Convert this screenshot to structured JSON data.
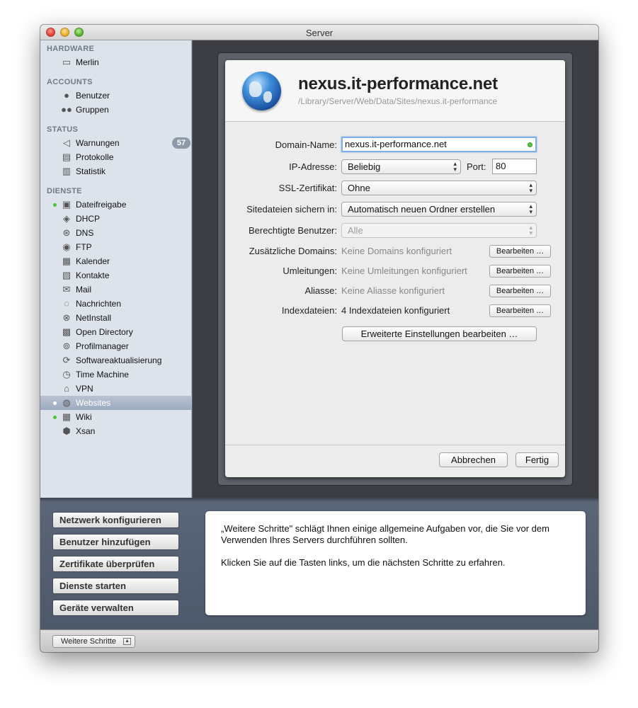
{
  "window": {
    "title": "Server"
  },
  "sidebar": {
    "sections": [
      {
        "title": "HARDWARE",
        "items": [
          {
            "label": "Merlin",
            "icon": "server-icon",
            "glyph": "▭"
          }
        ]
      },
      {
        "title": "ACCOUNTS",
        "items": [
          {
            "label": "Benutzer",
            "icon": "user-icon",
            "glyph": "●"
          },
          {
            "label": "Gruppen",
            "icon": "group-icon",
            "glyph": "●●"
          }
        ]
      },
      {
        "title": "STATUS",
        "items": [
          {
            "label": "Warnungen",
            "icon": "alert-megaphone-icon",
            "glyph": "◁",
            "badge": "57"
          },
          {
            "label": "Protokolle",
            "icon": "log-document-icon",
            "glyph": "▤"
          },
          {
            "label": "Statistik",
            "icon": "stats-bars-icon",
            "glyph": "▥"
          }
        ]
      },
      {
        "title": "DIENSTE",
        "items": [
          {
            "label": "Dateifreigabe",
            "icon": "file-sharing-icon",
            "glyph": "▣",
            "active": true
          },
          {
            "label": "DHCP",
            "icon": "dhcp-icon",
            "glyph": "◈"
          },
          {
            "label": "DNS",
            "icon": "dns-icon",
            "glyph": "⊛"
          },
          {
            "label": "FTP",
            "icon": "ftp-icon",
            "glyph": "◉"
          },
          {
            "label": "Kalender",
            "icon": "calendar-icon",
            "glyph": "▦"
          },
          {
            "label": "Kontakte",
            "icon": "contacts-icon",
            "glyph": "▧"
          },
          {
            "label": "Mail",
            "icon": "mail-icon",
            "glyph": "✉"
          },
          {
            "label": "Nachrichten",
            "icon": "messages-icon",
            "glyph": "◌"
          },
          {
            "label": "NetInstall",
            "icon": "netinstall-icon",
            "glyph": "⊗"
          },
          {
            "label": "Open Directory",
            "icon": "open-directory-icon",
            "glyph": "▩"
          },
          {
            "label": "Profilmanager",
            "icon": "profile-manager-icon",
            "glyph": "⊚"
          },
          {
            "label": "Softwareaktualisierung",
            "icon": "software-update-icon",
            "glyph": "⟳"
          },
          {
            "label": "Time Machine",
            "icon": "time-machine-icon",
            "glyph": "◷"
          },
          {
            "label": "VPN",
            "icon": "vpn-icon",
            "glyph": "⌂"
          },
          {
            "label": "Websites",
            "icon": "websites-globe-icon",
            "glyph": "◍",
            "active": true,
            "selected": true
          },
          {
            "label": "Wiki",
            "icon": "wiki-icon",
            "glyph": "▦",
            "active": true
          },
          {
            "label": "Xsan",
            "icon": "xsan-icon",
            "glyph": "⬢"
          }
        ]
      }
    ]
  },
  "sheet": {
    "site_name": "nexus.it-performance.net",
    "site_path": "/Library/Server/Web/Data/Sites/nexus.it-performance",
    "domain_label": "Domain-Name:",
    "domain_value": "nexus.it-performance.net",
    "ip_label": "IP-Adresse:",
    "ip_value": "Beliebig",
    "port_label": "Port:",
    "port_value": "80",
    "ssl_label": "SSL-Zertifikat:",
    "ssl_value": "Ohne",
    "backup_label": "Sitedateien sichern in:",
    "backup_value": "Automatisch neuen Ordner erstellen",
    "users_label": "Berechtigte Benutzer:",
    "users_value": "Alle",
    "rows": [
      {
        "label": "Zusätzliche Domains:",
        "value": "Keine Domains konfiguriert",
        "button": "Bearbeiten …",
        "dim": true
      },
      {
        "label": "Umleitungen:",
        "value": "Keine Umleitungen konfiguriert",
        "button": "Bearbeiten …",
        "dim": true
      },
      {
        "label": "Aliasse:",
        "value": "Keine Aliasse konfiguriert",
        "button": "Bearbeiten …",
        "dim": true
      },
      {
        "label": "Indexdateien:",
        "value": "4 Indexdateien konfiguriert",
        "button": "Bearbeiten …",
        "dim": false
      }
    ],
    "advanced_button": "Erweiterte Einstellungen bearbeiten …",
    "cancel_button": "Abbrechen",
    "done_button": "Fertig"
  },
  "next_steps": {
    "buttons": [
      "Netzwerk konfigurieren",
      "Benutzer hinzufügen",
      "Zertifikate überprüfen",
      "Dienste starten",
      "Geräte verwalten"
    ],
    "paragraph1": "„Weitere Schritte\" schlägt Ihnen einige allgemeine Aufgaben vor, die Sie vor dem Verwenden Ihres Servers durchführen sollten.",
    "paragraph2": "Klicken Sie auf die Tasten links, um die nächsten Schritte zu erfahren."
  },
  "statusbar": {
    "toggle_label": "Weitere Schritte"
  }
}
